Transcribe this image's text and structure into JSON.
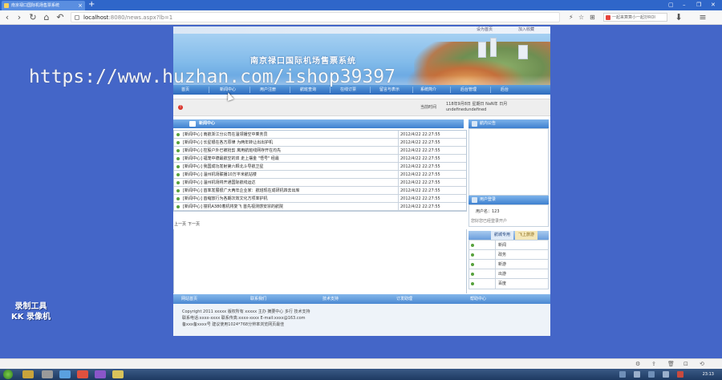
{
  "browser": {
    "tab_title": "南京禄口国际机场售票系统",
    "new_tab": "+",
    "url_host": "localhost",
    "url_rest": ":8080/news.aspx?lb=1",
    "search_text": "一起来算算小一起抄ROI",
    "nav": {
      "back": "‹",
      "forward": "›",
      "reload": "↻",
      "home": "⌂",
      "undo": "↶"
    },
    "win": {
      "restore": "▢",
      "min": "–",
      "max": "❐",
      "close": "✕"
    },
    "toolbar_icons": {
      "flash": "⚡",
      "star": "☆",
      "extensions": "⊞",
      "dl": "⬇",
      "menu": "≡"
    }
  },
  "site": {
    "top_links": {
      "set_home": "设为首页",
      "add_fav": "加入收藏"
    },
    "title": "南京禄口国际机场售票系统",
    "nav": [
      "首页",
      "新闻中心",
      "用户注册",
      "航班查询",
      "在线订票",
      "留言与表示",
      "系统简介",
      "后台管理",
      "后台"
    ],
    "infobar": {
      "current_time_label": "当前时间",
      "time_line1": "118年9月8日 星期日 NaN年 日月",
      "time_line2": "undefinedundefined"
    },
    "news": {
      "heading": "新闻中心",
      "rows": [
        {
          "title": "[新闻中心] 南航浙江分公司在温领播空中乘务员",
          "date": "2012/4/22 22:27:55"
        },
        {
          "title": "[新闻中心] 长星银在各方原律 为两年转让出出护机",
          "date": "2012/4/22 22:27:55"
        },
        {
          "title": "[新闻中心] 控股户外已被抢剪 离用航班线网存开在均先",
          "date": "2012/4/22 22:27:55"
        },
        {
          "title": "[新闻中心] 福笼中德最航空的双 走上摆金 \"悟号\" 经最",
          "date": "2012/4/22 22:27:55"
        },
        {
          "title": "[新闻中心] 我国成功发射第六颗北斗导航卫星",
          "date": "2012/4/22 22:27:55"
        },
        {
          "title": "[新闻中心] 温州机场联播10万平米航站楼",
          "date": "2012/4/22 22:27:55"
        },
        {
          "title": "[新闻中心] 温州机场将开通国际航线运达",
          "date": "2012/4/22 22:27:55"
        },
        {
          "title": "[新闻中心] 首率发展很广大两年企业家：航班现在成研机四去出库",
          "date": "2012/4/22 22:27:55"
        },
        {
          "title": "[新闻中心] 首缩放行为各期次效文化方项率护机",
          "date": "2012/4/22 22:27:55"
        },
        {
          "title": "[新闻中心] 撞机A380着机将复飞 首先视测感安宗的航院",
          "date": "2012/4/22 22:27:55"
        }
      ],
      "pager": [
        "上一页",
        "下一页"
      ]
    },
    "sidebar": {
      "box1_title": "航内公告",
      "box2_title": "用户登录",
      "user_line": "用户名：123",
      "user_line2": "您好您已经登录开户",
      "cat_tabs": [
        "航城专用",
        "飞上旅游"
      ],
      "categories": [
        "新闻",
        "政务",
        "新游",
        "出游",
        "百度"
      ]
    },
    "footer": {
      "nav": [
        "网站首页",
        "联系我们",
        "技术支持",
        "订发助理",
        "帮助中心"
      ],
      "lines": [
        "Copyright 2011 xxxxx 版权所有 xxxxx 主办 摘要中心 多行 技术支持",
        "联系电话:xxxx-xxxx 联系传真:xxxx-xxxx E-mail:xxxx@163.com",
        "备xxx备xxxx号  建议使用1024*768分辨率浏览网页最佳"
      ]
    }
  },
  "overlay": {
    "watermark": "https://www.huzhan.com/ishop39397",
    "recorder_line1": "录制工具",
    "recorder_line2": "KK 录像机"
  },
  "taskbar": {
    "clock": "23:13"
  },
  "colors": {
    "page_bg": "#4466c8",
    "nav_blue": "#2d6bbd",
    "bullet_green": "#58a23d"
  }
}
